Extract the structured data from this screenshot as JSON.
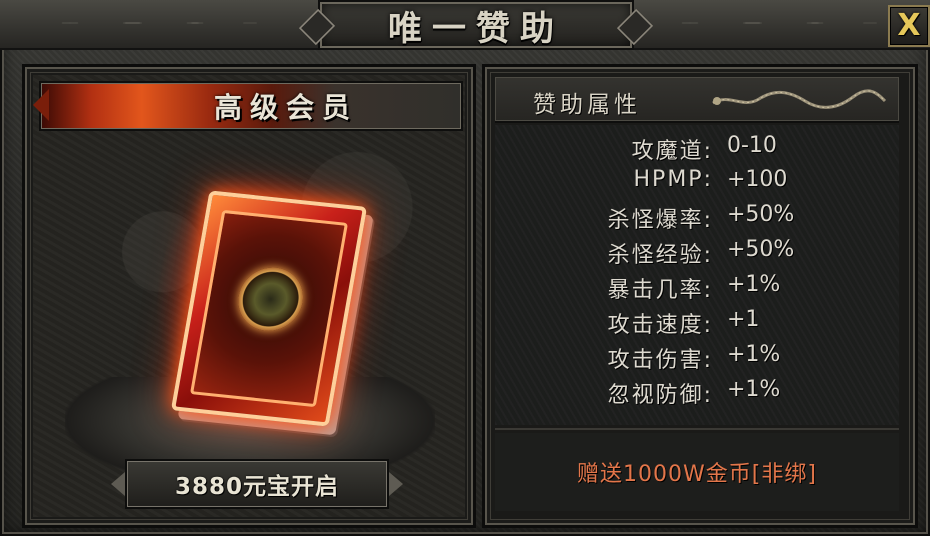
{
  "window": {
    "title": "唯一赞助",
    "close_label": "X"
  },
  "left_panel": {
    "banner_label": "高级会员",
    "open_button_label": "3880元宝开启"
  },
  "right_panel": {
    "header_title": "赞助属性",
    "attributes": [
      {
        "label": "攻魔道:",
        "value": "0-10"
      },
      {
        "label": "HPMP:",
        "value": "+100"
      },
      {
        "label": "杀怪爆率:",
        "value": "+50%"
      },
      {
        "label": "杀怪经验:",
        "value": "+50%"
      },
      {
        "label": "暴击几率:",
        "value": "+1%"
      },
      {
        "label": "攻击速度:",
        "value": "+1"
      },
      {
        "label": "攻击伤害:",
        "value": "+1%"
      },
      {
        "label": "忽视防御:",
        "value": "+1%"
      }
    ],
    "gift_text": "赠送1000W金币[非绑]"
  },
  "icons": [
    "close-icon",
    "dragon-ornament-icon",
    "vip-book-icon"
  ],
  "colors": {
    "accent_gold": "#e6c85a",
    "gift_text": "#e3764a",
    "panel_bg": "#1e1f1e"
  }
}
